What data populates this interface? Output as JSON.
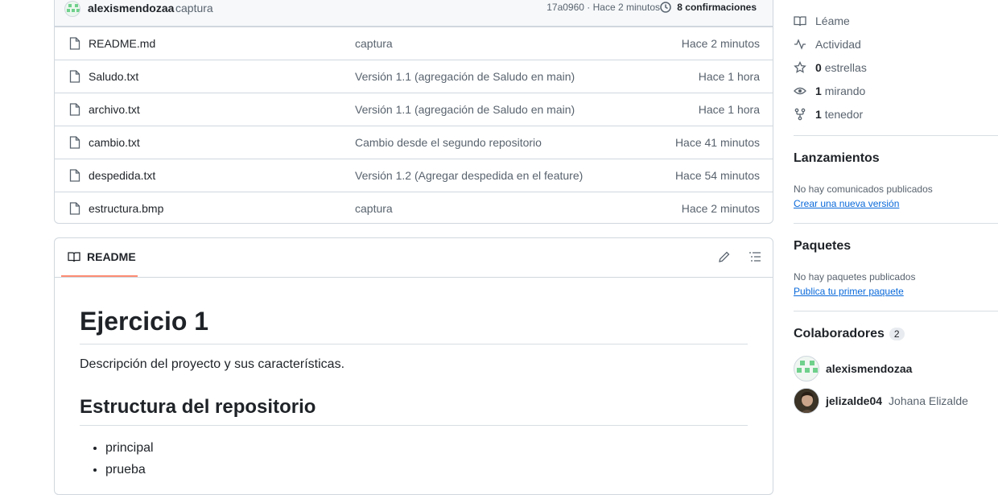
{
  "commit": {
    "author": "alexismendozaa",
    "message": "captura",
    "meta": "17a0960 · Hace 2 minutos",
    "count_label": "8 confirmaciones"
  },
  "files": [
    {
      "name": "README.md",
      "commit": "captura",
      "time": "Hace 2 minutos"
    },
    {
      "name": "Saludo.txt",
      "commit": "Versión 1.1 (agregación de Saludo en main)",
      "time": "Hace 1 hora"
    },
    {
      "name": "archivo.txt",
      "commit": "Versión 1.1 (agregación de Saludo en main)",
      "time": "Hace 1 hora"
    },
    {
      "name": "cambio.txt",
      "commit": "Cambio desde el segundo repositorio",
      "time": "Hace 41 minutos"
    },
    {
      "name": "despedida.txt",
      "commit": "Versión 1.2 (Agregar despedida en el feature)",
      "time": "Hace 54 minutos"
    },
    {
      "name": "estructura.bmp",
      "commit": "captura",
      "time": "Hace 2 minutos"
    }
  ],
  "readme": {
    "tab_label": "README",
    "h1": "Ejercicio 1",
    "description": "Descripción del proyecto y sus características.",
    "h2": "Estructura del repositorio",
    "items": [
      "principal",
      "prueba"
    ]
  },
  "sidebar": {
    "about": [
      {
        "icon": "book-icon",
        "strong": "",
        "label": "Léame"
      },
      {
        "icon": "pulse-icon",
        "strong": "",
        "label": "Actividad"
      },
      {
        "icon": "star-icon",
        "strong": "0",
        "label": "estrellas"
      },
      {
        "icon": "eye-icon",
        "strong": "1",
        "label": "mirando"
      },
      {
        "icon": "fork-icon",
        "strong": "1",
        "label": "tenedor"
      }
    ],
    "releases": {
      "title": "Lanzamientos",
      "text": "No hay comunicados publicados",
      "link": "Crear una nueva versión"
    },
    "packages": {
      "title": "Paquetes",
      "text": "No hay paquetes publicados",
      "link": "Publica tu primer paquete"
    },
    "contributors": {
      "title": "Colaboradores",
      "count": "2",
      "people": [
        {
          "login": "alexismendozaa",
          "fullname": ""
        },
        {
          "login": "jelizalde04",
          "fullname": "Johana Elizalde"
        }
      ]
    }
  },
  "colors": {
    "accent_link": "#0969da",
    "tab_underline": "#fd8c73",
    "identicon": "#6fd08c"
  }
}
